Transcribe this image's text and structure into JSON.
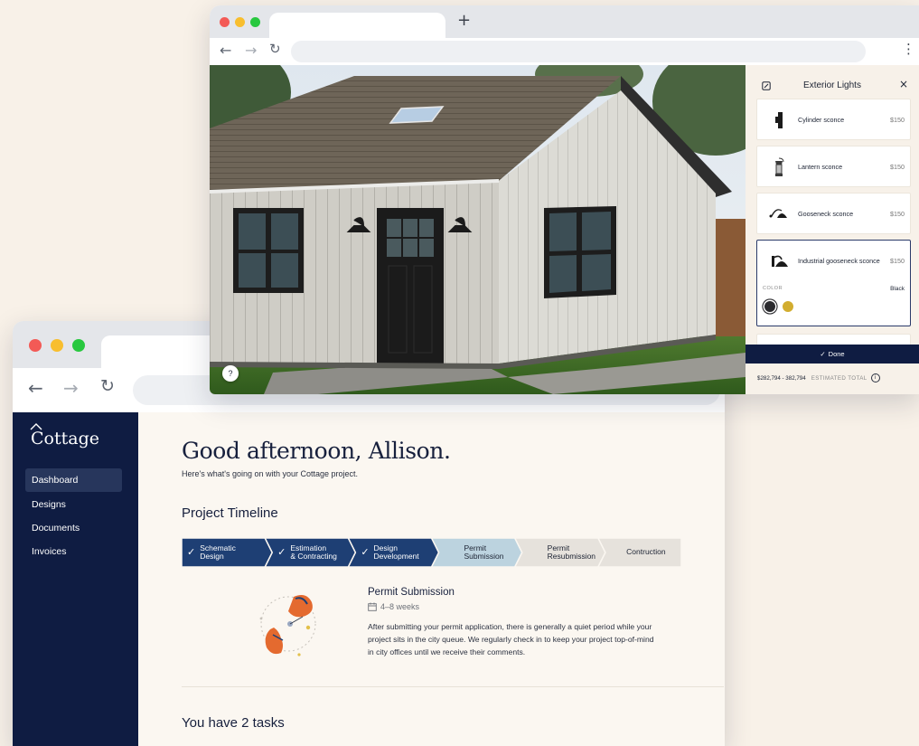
{
  "dashboard": {
    "brand": "Cottage",
    "nav": [
      "Dashboard",
      "Designs",
      "Documents",
      "Invoices"
    ],
    "greeting": "Good afternoon, Allison.",
    "subtitle": "Here's what's going on with your Cottage project.",
    "timeline_title": "Project Timeline",
    "steps": [
      {
        "line1": "Schematic",
        "line2": "Design",
        "status": "complete"
      },
      {
        "line1": "Estimation",
        "line2": "& Contracting",
        "status": "complete"
      },
      {
        "line1": "Design",
        "line2": "Development",
        "status": "complete"
      },
      {
        "line1": "Permit",
        "line2": "Submission",
        "status": "current"
      },
      {
        "line1": "Permit",
        "line2": "Resubmission",
        "status": "upcoming"
      },
      {
        "line1": "Contruction",
        "line2": "",
        "status": "upcoming"
      }
    ],
    "permit": {
      "title": "Permit Submission",
      "duration": "4–8 weeks",
      "description": "After submitting your permit application, there is generally a quiet period while your project sits in the city queue. We regularly check in to keep your project top-of-mind in city offices until we receive their comments."
    },
    "tasks_heading": "You have 2 tasks"
  },
  "configurator": {
    "panel_title": "Exterior Lights",
    "items": [
      {
        "name": "Cylinder sconce",
        "price": "$150",
        "icon": "cylinder-sconce-icon"
      },
      {
        "name": "Lantern sconce",
        "price": "$150",
        "icon": "lantern-sconce-icon"
      },
      {
        "name": "Gooseneck sconce",
        "price": "$150",
        "icon": "gooseneck-sconce-icon"
      },
      {
        "name": "Industrial gooseneck sconce",
        "price": "$150",
        "icon": "industrial-gooseneck-icon"
      }
    ],
    "color_label": "COLOR",
    "color_value": "Black",
    "swatches": [
      "#2a2a2e",
      "#d2ad2f"
    ],
    "done_label": "Done",
    "estimate_range": "$282,794 - 382,794",
    "estimate_label": "ESTIMATED TOTAL",
    "help_glyph": "?"
  },
  "colors": {
    "navy": "#0f1c42",
    "step_complete": "#1e3f74",
    "step_current": "#bcd3df",
    "step_upcoming": "#e6e2dc",
    "background": "#f8f1e8"
  }
}
